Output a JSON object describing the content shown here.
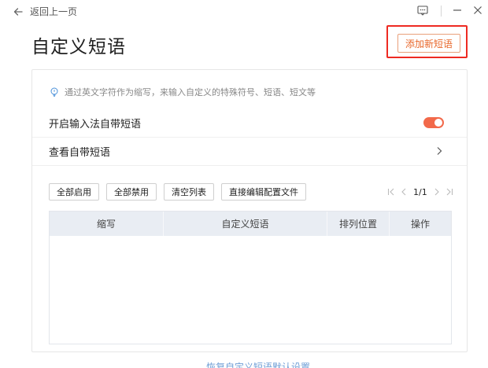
{
  "topbar": {
    "back_label": "返回上一页"
  },
  "page": {
    "title": "自定义短语",
    "add_button_label": "添加新短语"
  },
  "panel": {
    "hint": "通过英文字符作为缩写，来输入自定义的特殊符号、短语、短文等",
    "enable_row_label": "开启输入法自带短语",
    "enable_toggle_on": true,
    "view_row_label": "查看自带短语",
    "buttons": {
      "enable_all": "全部启用",
      "disable_all": "全部禁用",
      "clear_list": "清空列表",
      "edit_config": "直接编辑配置文件"
    },
    "pager": {
      "page_text": "1/1"
    },
    "table": {
      "columns": [
        "缩写",
        "自定义短语",
        "排列位置",
        "操作"
      ]
    }
  },
  "footer": {
    "restore_link": "恢复自定义短语默认设置"
  },
  "colors": {
    "accent": "#e8672a",
    "toggle_on": "#f2694a",
    "annotation_red": "#ee2a22",
    "table_header": "#e9edf3",
    "link": "#6e9ed6"
  },
  "icons": {
    "back": "arrow-left-icon",
    "feedback": "message-icon",
    "minimize": "minimize-icon",
    "close": "close-icon",
    "hint": "lightbulb-icon",
    "chevron": "chevron-right-icon"
  }
}
